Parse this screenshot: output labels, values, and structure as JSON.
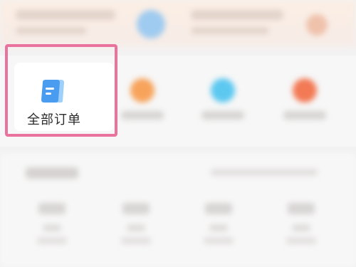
{
  "orders": {
    "all_orders_label": "全部订单"
  },
  "colors": {
    "highlight": "#e9739c",
    "order_icon": "#4a9cf0",
    "pending_payment": "#f7a35c",
    "pending_delivery": "#5cc8f0",
    "pending_receipt": "#f27a55"
  },
  "icons": {
    "all_orders": "document-icon"
  }
}
